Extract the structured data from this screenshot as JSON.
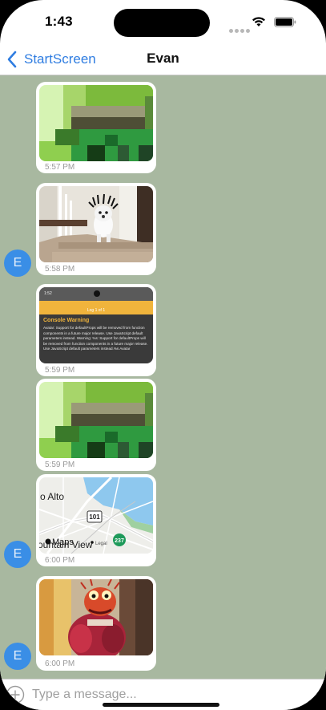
{
  "status_bar": {
    "time": "1:43"
  },
  "nav": {
    "back_label": "StartScreen",
    "title": "Evan"
  },
  "messages": [
    {
      "time": "5:57 PM",
      "image": "pixel-art-image"
    },
    {
      "time": "5:58 PM",
      "image": "dog-photo"
    },
    {
      "time": "5:59 PM",
      "image": "console-warning-screenshot"
    },
    {
      "time": "5:59 PM",
      "image": "pixel-art-image"
    },
    {
      "time": "6:00 PM",
      "image": "map-snapshot"
    },
    {
      "time": "6:00 PM",
      "image": "puppet-photo"
    }
  ],
  "avatar": {
    "initial": "E",
    "color": "#3a8ee6"
  },
  "console_shot": {
    "status_time": "1:52",
    "log_header": "Log 1 of 1",
    "warning_title": "Console Warning",
    "warning_body": "Avatar: Support for defaultProps will be removed from function components in a future major release. Use JavaScript default parameters instead. Warning: %s: Support for defaultProps will be removed from function components in a future major release. Use JavaScript default parameters instead.%s Avatar"
  },
  "map": {
    "place_top": "o Alto",
    "place_bottom": "ountain View",
    "route_1": "101",
    "route_2": "237",
    "brand": "Maps",
    "legal": "Legal"
  },
  "composer": {
    "placeholder": "Type a message..."
  },
  "colors": {
    "chat_background": "#a8b8a0",
    "accent": "#2f7de1",
    "warning": "#f0b43c"
  }
}
